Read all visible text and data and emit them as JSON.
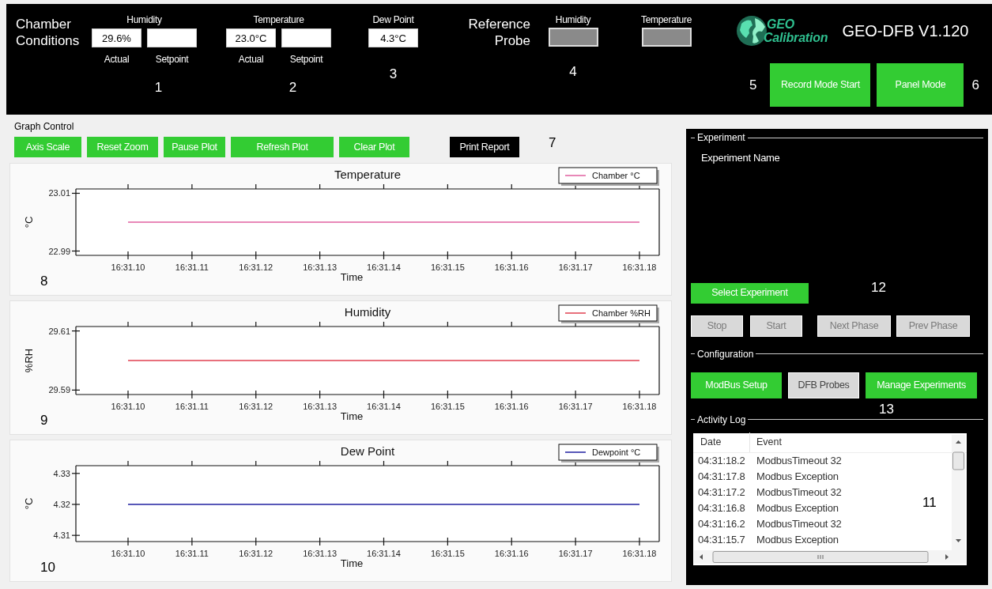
{
  "header": {
    "title": "Chamber Conditions",
    "groups": [
      {
        "label": "Humidity",
        "fields": [
          {
            "value": "29.6%",
            "caption": "Actual"
          },
          {
            "caption": "Setpoint"
          }
        ],
        "callout": "1"
      },
      {
        "label": "Temperature",
        "fields": [
          {
            "value": "23.0°C",
            "caption": "Actual"
          },
          {
            "caption": "Setpoint"
          }
        ],
        "callout": "2"
      },
      {
        "label": "Dew Point",
        "fields": [
          {
            "value": "4.3°C"
          }
        ],
        "callout": "3"
      }
    ],
    "reference": {
      "title": "Reference Probe",
      "fields": [
        {
          "label": "Humidity",
          "disabled": true,
          "callout": "4"
        },
        {
          "label": "Temperature",
          "disabled": true
        }
      ]
    },
    "logo": {
      "lines": [
        "GEO",
        "Calibration"
      ]
    },
    "app_title": "GEO-DFB V1.120",
    "callouts": [
      "5",
      "6"
    ],
    "buttons": [
      {
        "label": "Record Mode Start",
        "kind": "action"
      },
      {
        "label": "Panel Mode",
        "kind": "action"
      }
    ]
  },
  "graph_control": {
    "title": "Graph Control",
    "callout": "7",
    "buttons": [
      {
        "label": "Axis Scale",
        "kind": "action"
      },
      {
        "label": "Reset Zoom",
        "kind": "action"
      },
      {
        "label": "Pause Plot",
        "kind": "action"
      },
      {
        "label": "Refresh Plot",
        "kind": "action"
      },
      {
        "label": "Clear Plot",
        "kind": "action"
      },
      {
        "label": "Print Report",
        "kind": "report"
      }
    ],
    "charts": [
      {
        "callout": "8",
        "chart_data": {
          "type": "line",
          "title": "Temperature",
          "xlabel": "Time",
          "ylabel": "°C",
          "categories": [
            "16:31.10",
            "16:31.11",
            "16:31.12",
            "16:31.13",
            "16:31.14",
            "16:31.15",
            "16:31.16",
            "16:31.17",
            "16:31.18"
          ],
          "series": [
            {
              "name": "Chamber °C",
              "color": "#e060a0",
              "values": [
                23.0,
                23.0,
                23.0,
                23.0,
                23.0,
                23.0,
                23.0,
                23.0,
                23.0
              ]
            }
          ],
          "ylim": [
            22.9885,
            23.0115
          ],
          "yticks": [
            22.99,
            23.01
          ]
        }
      },
      {
        "callout": "9",
        "chart_data": {
          "type": "line",
          "title": "Humidity",
          "xlabel": "Time",
          "ylabel": "%RH",
          "categories": [
            "16:31.10",
            "16:31.11",
            "16:31.12",
            "16:31.13",
            "16:31.14",
            "16:31.15",
            "16:31.16",
            "16:31.17",
            "16:31.18"
          ],
          "series": [
            {
              "name": "Chamber %RH",
              "color": "#e04050",
              "values": [
                29.6,
                29.6,
                29.6,
                29.6,
                29.6,
                29.6,
                29.6,
                29.6,
                29.6
              ]
            }
          ],
          "ylim": [
            29.5885,
            29.6115
          ],
          "yticks": [
            29.59,
            29.61
          ]
        }
      },
      {
        "callout": "10",
        "chart_data": {
          "type": "line",
          "title": "Dew Point",
          "xlabel": "Time",
          "ylabel": "°C",
          "categories": [
            "16:31.10",
            "16:31.11",
            "16:31.12",
            "16:31.13",
            "16:31.14",
            "16:31.15",
            "16:31.16",
            "16:31.17",
            "16:31.18"
          ],
          "series": [
            {
              "name": "Dewpoint °C",
              "color": "#2020a0",
              "values": [
                4.32,
                4.32,
                4.32,
                4.32,
                4.32,
                4.32,
                4.32,
                4.32,
                4.32
              ]
            }
          ],
          "ylim": [
            4.308,
            4.3325
          ],
          "yticks": [
            4.31,
            4.32,
            4.33
          ]
        }
      }
    ]
  },
  "experiment": {
    "title": "Experiment",
    "name_label": "Experiment Name",
    "select_button": {
      "label": "Select Experiment",
      "kind": "action"
    },
    "callout": "12",
    "buttons": [
      {
        "label": "Stop",
        "kind": "plain",
        "disabled": true
      },
      {
        "label": "Start",
        "kind": "plain",
        "disabled": true
      },
      {
        "label": "Next Phase",
        "kind": "plain",
        "disabled": true
      },
      {
        "label": "Prev Phase",
        "kind": "plain",
        "disabled": true
      }
    ]
  },
  "configuration": {
    "title": "Configuration",
    "callout": "13",
    "buttons": [
      {
        "label": "ModBus Setup",
        "kind": "action",
        "disabled": false
      },
      {
        "label": "DFB Probes",
        "kind": "plain",
        "disabled": false
      },
      {
        "label": "Manage Experiments",
        "kind": "action",
        "disabled": false
      }
    ]
  },
  "activity_log": {
    "title": "Activity Log",
    "callout": "11",
    "columns": [
      "Date",
      "Event"
    ],
    "rows": [
      [
        "04:31:18.2",
        "ModbusTimeout 32"
      ],
      [
        "04:31:17.8",
        "Modbus Exception"
      ],
      [
        "04:31:17.2",
        "ModbusTimeout 32"
      ],
      [
        "04:31:16.8",
        "Modbus Exception"
      ],
      [
        "04:31:16.2",
        "ModbusTimeout 32"
      ],
      [
        "04:31:15.7",
        "Modbus Exception"
      ]
    ]
  }
}
